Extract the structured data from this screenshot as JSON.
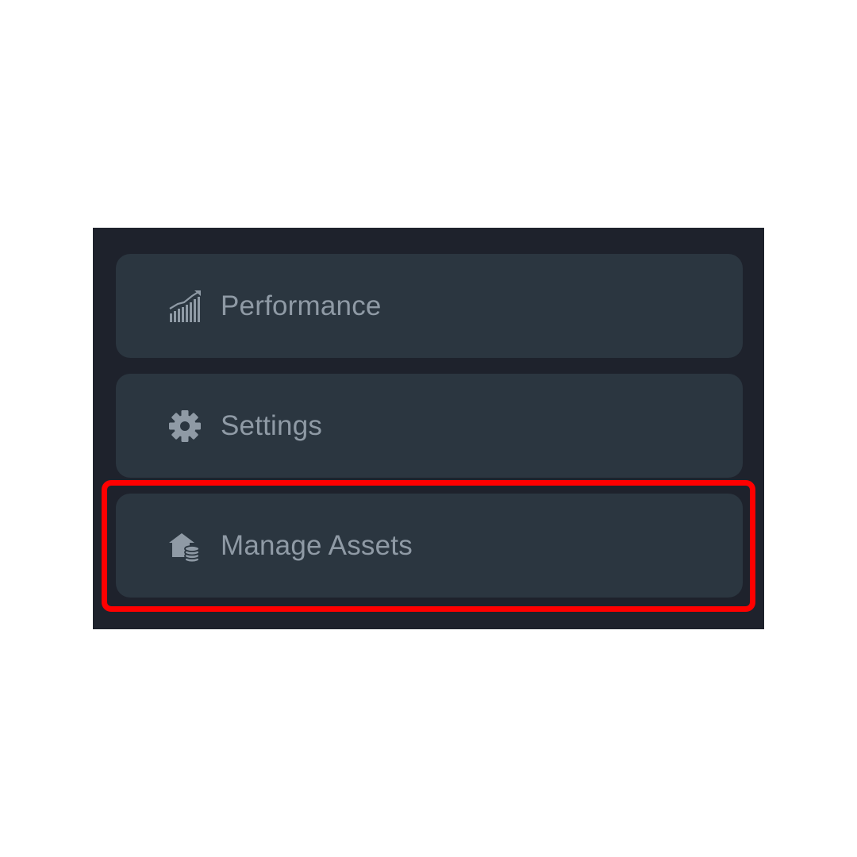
{
  "menu": {
    "items": [
      {
        "label": "Performance",
        "icon": "performance-chart-icon"
      },
      {
        "label": "Settings",
        "icon": "gear-icon"
      },
      {
        "label": "Manage Assets",
        "icon": "assets-house-coins-icon"
      }
    ],
    "highlighted_item": "Manage Assets"
  },
  "colors": {
    "panel_background": "#1e222c",
    "item_background": "#2b3640",
    "text": "#8f9aa5",
    "highlight": "#ff0000"
  }
}
